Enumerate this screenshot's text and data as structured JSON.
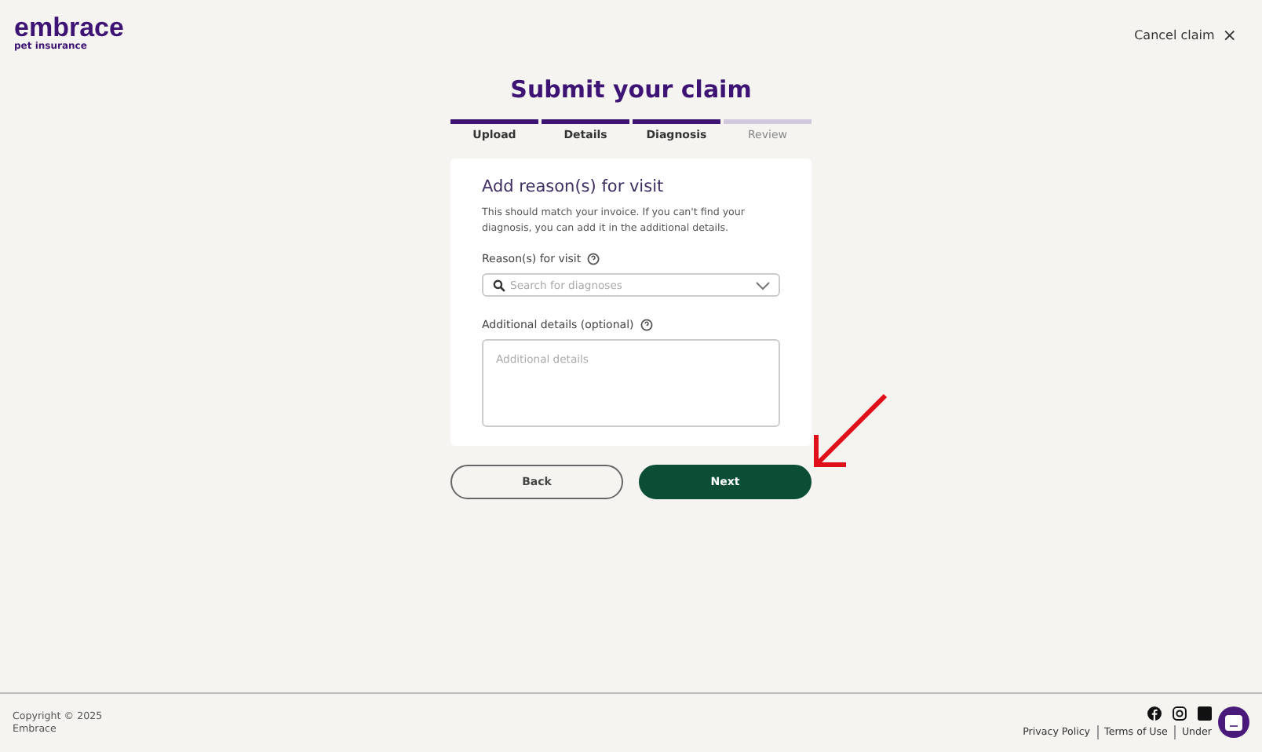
{
  "header": {
    "logo": "embrace",
    "logo_tagline": "pet insurance",
    "cancel": "Cancel claim",
    "cancel_icon": "×"
  },
  "title": "Submit your claim",
  "steps": [
    {
      "label": "Upload",
      "done": true
    },
    {
      "label": "Details",
      "done": true
    },
    {
      "label": "Diagnosis",
      "done": true
    },
    {
      "label": "Review",
      "done": false
    }
  ],
  "card": {
    "heading": "Add reason(s) for visit",
    "description": "This should match your invoice. If you can't find your diagnosis, you can add it in the additional details.",
    "reason_label": "Reason(s) for visit",
    "reason_placeholder": "Search for diagnoses",
    "details_label": "Additional details (optional)",
    "details_placeholder": "Additional details"
  },
  "buttons": {
    "back": "Back",
    "next": "Next"
  },
  "footer": {
    "copyright": "Copyright © 2025",
    "company": "Embrace",
    "links": [
      "Privacy Policy",
      "Terms of Use",
      "Under"
    ]
  }
}
